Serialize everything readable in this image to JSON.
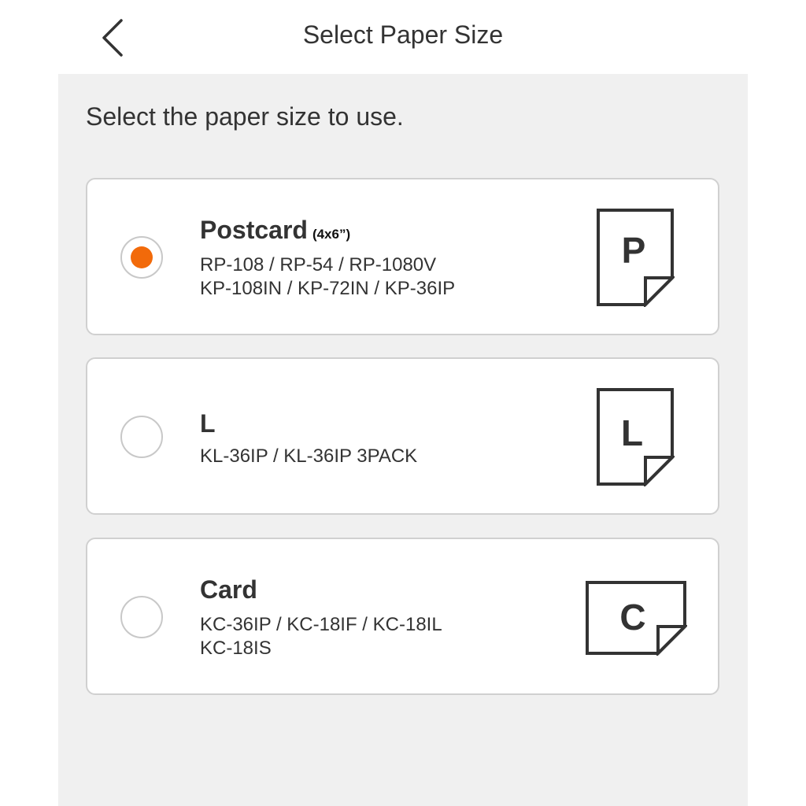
{
  "header": {
    "title": "Select Paper Size",
    "back_icon": "chevron-left-icon"
  },
  "instruction": "Select the paper size to use.",
  "accent_color": "#f26a0a",
  "options": [
    {
      "title": "Postcard",
      "subtitle": "(4x6”)",
      "models_line1": "RP-108 / RP-54 / RP-1080V",
      "models_line2": "KP-108IN / KP-72IN / KP-36IP",
      "icon_letter": "P",
      "icon": "portrait-paper-icon",
      "selected": true
    },
    {
      "title": "L",
      "models_line1": "KL-36IP / KL-36IP 3PACK",
      "icon_letter": "L",
      "icon": "portrait-paper-icon",
      "selected": false
    },
    {
      "title": "Card",
      "models_line1": "KC-36IP / KC-18IF / KC-18IL",
      "models_line2": "KC-18IS",
      "icon_letter": "C",
      "icon": "landscape-paper-icon",
      "selected": false
    }
  ]
}
